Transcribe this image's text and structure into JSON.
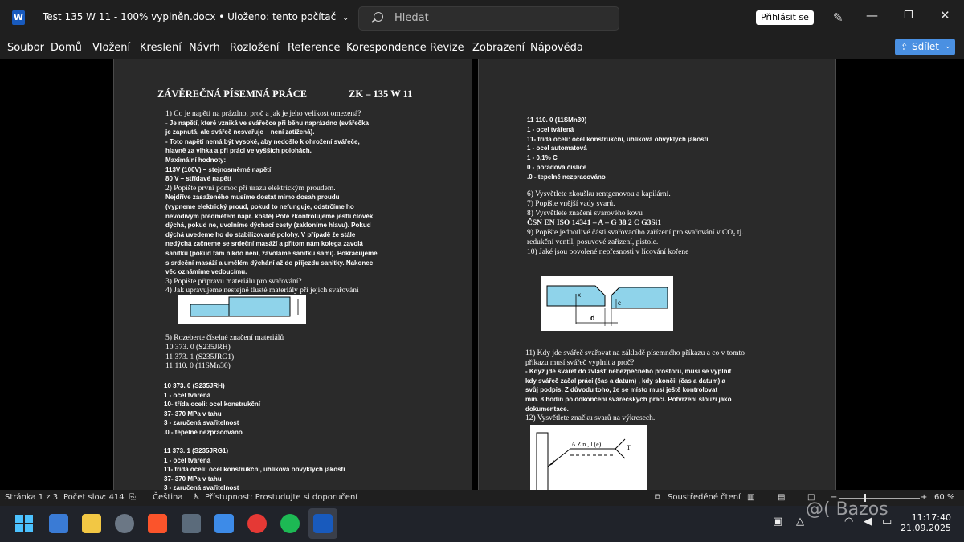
{
  "window": {
    "title": "Test 135 W 11 - 100% vyplněn.docx",
    "save_status": "Uloženo: tento počítač",
    "sign_in": "Přihlásit se"
  },
  "search": {
    "placeholder": "Hledat"
  },
  "menu": [
    "Soubor",
    "Domů",
    "Vložení",
    "Kreslení",
    "Návrh",
    "Rozložení",
    "Reference",
    "Korespondence",
    "Revize",
    "Zobrazení",
    "Nápověda"
  ],
  "share": {
    "label": "Sdílet"
  },
  "page1": {
    "heading_left": "ZÁVĚREČNÁ PÍSEMNÁ PRÁCE",
    "heading_right": "ZK – 135 W 11",
    "lines": [
      {
        "t": "1)  Co je napětí na prázdno, proč a jak je jeho velikost omezená?",
        "s": "serif"
      },
      {
        "t": "-     Je napětí, které vzniká ve svářečce při běhu naprázdno (svářečka",
        "s": "bold"
      },
      {
        "t": "      je zapnutá, ale svářeč nesvařuje – není zatížená).",
        "s": "bold"
      },
      {
        "t": "-     Toto napětí nemá být vysoké, aby nedošlo k ohrožení svářeče,",
        "s": "bold"
      },
      {
        "t": "      hlavně za vlhka a při práci ve vyšších polohách.",
        "s": "bold"
      },
      {
        "t": "Maximální hodnoty:",
        "s": "bold"
      },
      {
        "t": "113V (100V) – stejnosměrné napětí",
        "s": "bold"
      },
      {
        "t": "80 V                – střídavé napětí",
        "s": "bold"
      },
      {
        "t": "2)  Popište první pomoc při úrazu elektrickým proudem.",
        "s": "serif"
      },
      {
        "t": "Nejdříve zasaženého musíme dostat mimo dosah proudu",
        "s": "bold"
      },
      {
        "t": "(vypneme elektrický proud, pokud to nefunguje, odstrčíme ho",
        "s": "bold"
      },
      {
        "t": "nevodivým předmětem např. koště) Poté zkontrolujeme jestli člověk",
        "s": "bold"
      },
      {
        "t": "dýchá, pokud ne, uvolníme dýchací cesty (zakloníme hlavu). Pokud",
        "s": "bold"
      },
      {
        "t": "dýchá uvedeme ho do stabilizované polohy. V případě že stále",
        "s": "bold"
      },
      {
        "t": "nedýchá začneme se srdeční masáží a přitom nám kolega zavolá",
        "s": "bold"
      },
      {
        "t": "sanitku (pokud tam nikdo není, zavoláme sanitku sami). Pokračujeme",
        "s": "bold"
      },
      {
        "t": "s srdeční masáží a umělém dýchání až do příjezdu sanitky. Nakonec",
        "s": "bold"
      },
      {
        "t": "věc oznámíme vedoucímu.",
        "s": "bold"
      },
      {
        "t": "3)  Popište přípravu materiálu pro svařování?",
        "s": "serif"
      },
      {
        "t": "4)  Jak upravujeme nestejně tlusté materiály při jejich svařování",
        "s": "serif"
      }
    ],
    "lines_b": [
      {
        "t": "5)  Rozeberte číselné značení materiálů",
        "s": "serif"
      },
      {
        "t": "      10 373. 0 (S235JRH)",
        "s": "serif"
      },
      {
        "t": "      11 373. 1 (S235JRG1)",
        "s": "serif"
      },
      {
        "t": "      11 110. 0 (11SMn30)",
        "s": "serif"
      }
    ],
    "lines_c": [
      {
        "t": "   10 373. 0 (S235JRH)",
        "s": "bold"
      },
      {
        "t": " 1  - ocel tvářená",
        "s": "bold"
      },
      {
        "t": "10- třída oceli: ocel konstrukční",
        "s": "bold"
      },
      {
        "t": "37- 370 MPa v tahu",
        "s": "bold"
      },
      {
        "t": " 3  - zaručená svařitelnost",
        "s": "bold"
      },
      {
        "t": ".0  - tepelně nezpracováno",
        "s": "bold"
      }
    ],
    "lines_d": [
      {
        "t": "   11 373. 1 (S235JRG1)",
        "s": "bold"
      },
      {
        "t": " 1  - ocel tvářená",
        "s": "bold"
      },
      {
        "t": "11- třída oceli: ocel konstrukční, uhlíková obvyklých jakostí",
        "s": "bold"
      },
      {
        "t": "37- 370 MPa v tahu",
        "s": "bold"
      },
      {
        "t": " 3  - zaručená svařitelnost",
        "s": "bold"
      }
    ]
  },
  "page2": {
    "lines_a": [
      {
        "t": "   11 110. 0 (11SMn30)",
        "s": "bold"
      },
      {
        "t": " 1  - ocel tvářená",
        "s": "bold"
      },
      {
        "t": "11- třída oceli: ocel konstrukční, uhlíková obvyklých jakostí",
        "s": "bold"
      },
      {
        "t": " 1  - ocel automatová",
        "s": "bold"
      },
      {
        "t": " 1  - 0,1% C",
        "s": "bold"
      },
      {
        "t": " 0  - pořadová číslice",
        "s": "bold"
      },
      {
        "t": ".0  - tepelně nezpracováno",
        "s": "bold"
      }
    ],
    "lines_b": [
      {
        "t": "6)  Vysvětlete zkoušku rentgenovou a kapilární.",
        "s": "serif"
      },
      {
        "t": "7)  Popište vnější vady svarů.",
        "s": "serif"
      },
      {
        "t": "8)  Vysvětlete značení svarového kovu",
        "s": "serif"
      },
      {
        "t": "     ČSN EN ISO 14341  – A – G 38 2 C G3Si1",
        "s": "serifb"
      },
      {
        "t": "9)  Popište jednotlivé části svařovacího zařízení pro svařování v CO₂ tj.",
        "s": "serif"
      },
      {
        "t": "     redukční ventil, posuvové zařízení, pistole.",
        "s": "serif"
      },
      {
        "t": "10)  Jaké jsou povolené nepřesnosti v lícování kořene",
        "s": "serif"
      }
    ],
    "lines_c": [
      {
        "t": "11)  Kdy jde svářeč svařovat na základě písemného příkazu a co v tomto",
        "s": "serif"
      },
      {
        "t": "       příkazu musí svářeč vyplnit a proč?",
        "s": "serif"
      },
      {
        "t": "       -   Když jde svářet do zvlášť nebezpečného prostoru, musí se vyplnit",
        "s": "bold"
      },
      {
        "t": "           kdy svářeč začal práci (čas a datum) , kdy skončil (čas a datum) a",
        "s": "bold"
      },
      {
        "t": "           svůj podpis. Z důvodu toho, že se místo musí ještě kontrolovat",
        "s": "bold"
      },
      {
        "t": "           min. 8 hodin po dokončení svářečských prací. Potvrzení slouží jako",
        "s": "bold"
      },
      {
        "t": "           dokumentace.",
        "s": "bold"
      },
      {
        "t": " 12) Vysvětlete značku svarů na výkresech.",
        "s": "serif"
      }
    ],
    "diagram": {
      "label_x": "x",
      "label_c": "c",
      "label_d": "d"
    },
    "symbol": {
      "text": "A Z n , l (e)",
      "tail": "T"
    }
  },
  "status": {
    "page": "Stránka 1 z 3",
    "words": "Počet slov: 414",
    "language": "Čeština",
    "accessibility": "Přístupnost: Prostudujte si doporučení",
    "focus": "Soustředěné čtení",
    "zoom_minus": "−",
    "zoom_plus": "+",
    "zoom": "60 %"
  },
  "taskbar": {
    "time": "11:17:40",
    "date": "21.09.2025",
    "watermark": "@( Bazos"
  },
  "colors": {
    "accent": "#4a90e2",
    "word": "#185abd",
    "diagram_fill": "#8fd3ea"
  }
}
